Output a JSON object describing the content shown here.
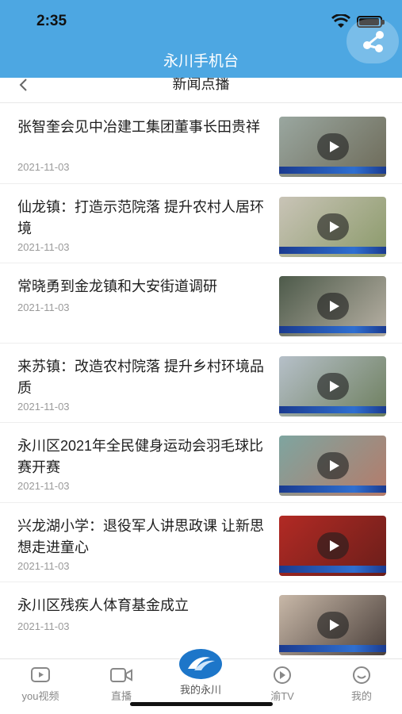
{
  "status_bar": {
    "time": "2:35"
  },
  "header": {
    "title": "永川手机台"
  },
  "navbar": {
    "title": "新闻点播"
  },
  "news": [
    {
      "title": "张智奎会见中冶建工集团董事长田贵祥",
      "date": "2021-11-03",
      "bg": [
        "#9aa7a0",
        "#6d6a58"
      ]
    },
    {
      "title": "仙龙镇：打造示范院落 提升农村人居环境",
      "date": "2021-11-03",
      "bg": [
        "#c9c4b7",
        "#8b9a6a"
      ]
    },
    {
      "title": "常晓勇到金龙镇和大安街道调研",
      "date": "2021-11-03",
      "bg": [
        "#4d5a4a",
        "#b8b1a4"
      ]
    },
    {
      "title": "来苏镇：改造农村院落 提升乡村环境品质",
      "date": "2021-11-03",
      "bg": [
        "#b6c0c9",
        "#6e7f5e"
      ]
    },
    {
      "title": "永川区2021年全民健身运动会羽毛球比赛开赛",
      "date": "2021-11-03",
      "bg": [
        "#7ea5a0",
        "#b57b6a"
      ]
    },
    {
      "title": "兴龙湖小学：退役军人讲思政课 让新思想走进童心",
      "date": "2021-11-03",
      "bg": [
        "#b22a24",
        "#6a1e1a"
      ]
    },
    {
      "title": "永川区残疾人体育基金成立",
      "date": "2021-11-03",
      "bg": [
        "#c8b8a8",
        "#4a3f3a"
      ]
    }
  ],
  "tabs": [
    {
      "label": "you视频",
      "icon": "video-icon"
    },
    {
      "label": "直播",
      "icon": "camera-icon"
    },
    {
      "label": "我的永川",
      "icon": "app-logo-icon"
    },
    {
      "label": "渝TV",
      "icon": "tv-play-icon"
    },
    {
      "label": "我的",
      "icon": "smile-icon"
    }
  ],
  "colors": {
    "header_bg": "#4da7e2",
    "text_gray": "#9a9a9a"
  }
}
